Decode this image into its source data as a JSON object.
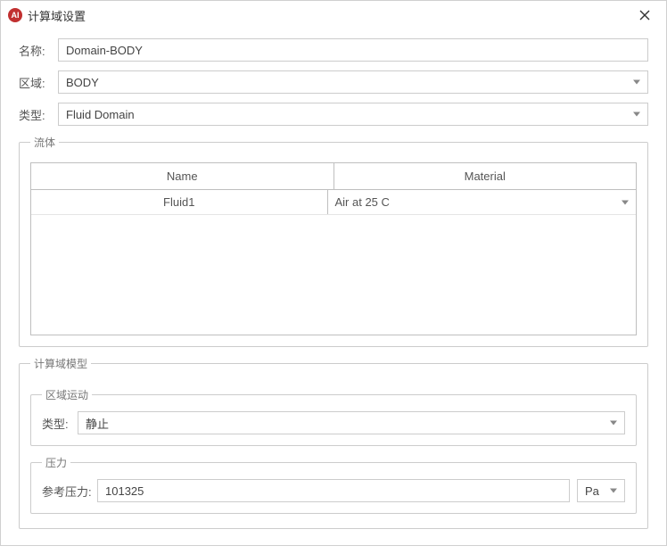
{
  "window": {
    "title": "计算域设置",
    "app_icon_text": "AI"
  },
  "labels": {
    "name": "名称:",
    "zone": "区域:",
    "type": "类型:",
    "fluid_group": "流体",
    "model_group": "计算域模型",
    "zone_motion_group": "区域运动",
    "pressure_group": "压力",
    "ref_pressure": "参考压力:"
  },
  "fields": {
    "name_value": "Domain-BODY",
    "zone_value": "BODY",
    "type_value": "Fluid Domain",
    "zone_motion_type": "静止",
    "ref_pressure_value": "101325",
    "ref_pressure_unit": "Pa"
  },
  "fluid_table": {
    "headers": {
      "name": "Name",
      "material": "Material"
    },
    "rows": [
      {
        "name": "Fluid1",
        "material": "Air at 25 C"
      }
    ]
  }
}
